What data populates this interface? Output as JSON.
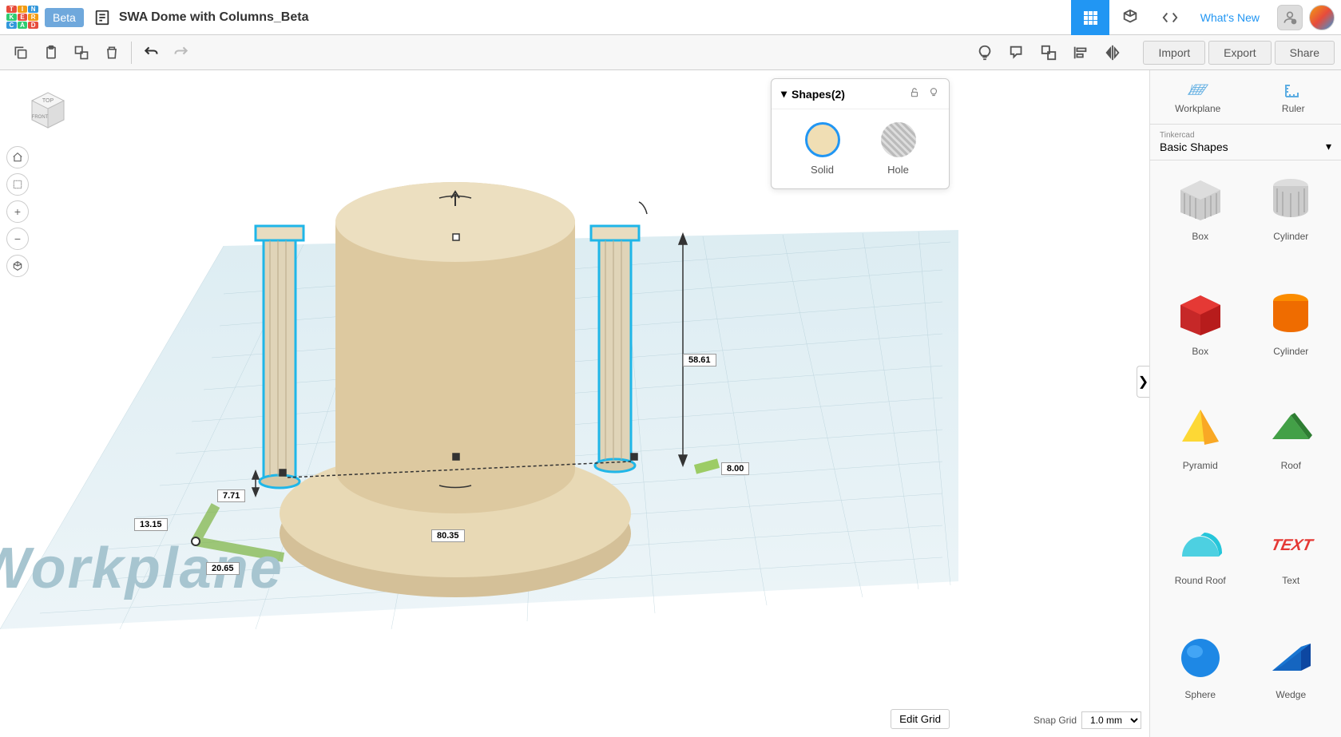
{
  "header": {
    "beta_label": "Beta",
    "doc_title": "SWA Dome with Columns_Beta",
    "whats_new": "What's New"
  },
  "toolbar": {
    "import_label": "Import",
    "export_label": "Export",
    "share_label": "Share"
  },
  "view_cube": {
    "top": "TOP",
    "front": "FRONT"
  },
  "shapes_panel": {
    "title": "Shapes(2)",
    "solid_label": "Solid",
    "hole_label": "Hole"
  },
  "sidebar": {
    "workplane_label": "Workplane",
    "ruler_label": "Ruler",
    "selector_category": "Tinkercad",
    "selector_value": "Basic Shapes",
    "shapes": [
      {
        "label": "Box"
      },
      {
        "label": "Cylinder"
      },
      {
        "label": "Box"
      },
      {
        "label": "Cylinder"
      },
      {
        "label": "Pyramid"
      },
      {
        "label": "Roof"
      },
      {
        "label": "Round Roof"
      },
      {
        "label": "Text"
      },
      {
        "label": "Sphere"
      },
      {
        "label": "Wedge"
      }
    ]
  },
  "measurements": {
    "height": "58.61",
    "width": "80.35",
    "offset_x": "20.65",
    "offset_y": "13.15",
    "depth": "7.71",
    "elevation": "8.00"
  },
  "bottom": {
    "edit_grid": "Edit Grid",
    "snap_label": "Snap Grid",
    "snap_value": "1.0 mm"
  },
  "canvas": {
    "workplane_text": "Workplane"
  }
}
